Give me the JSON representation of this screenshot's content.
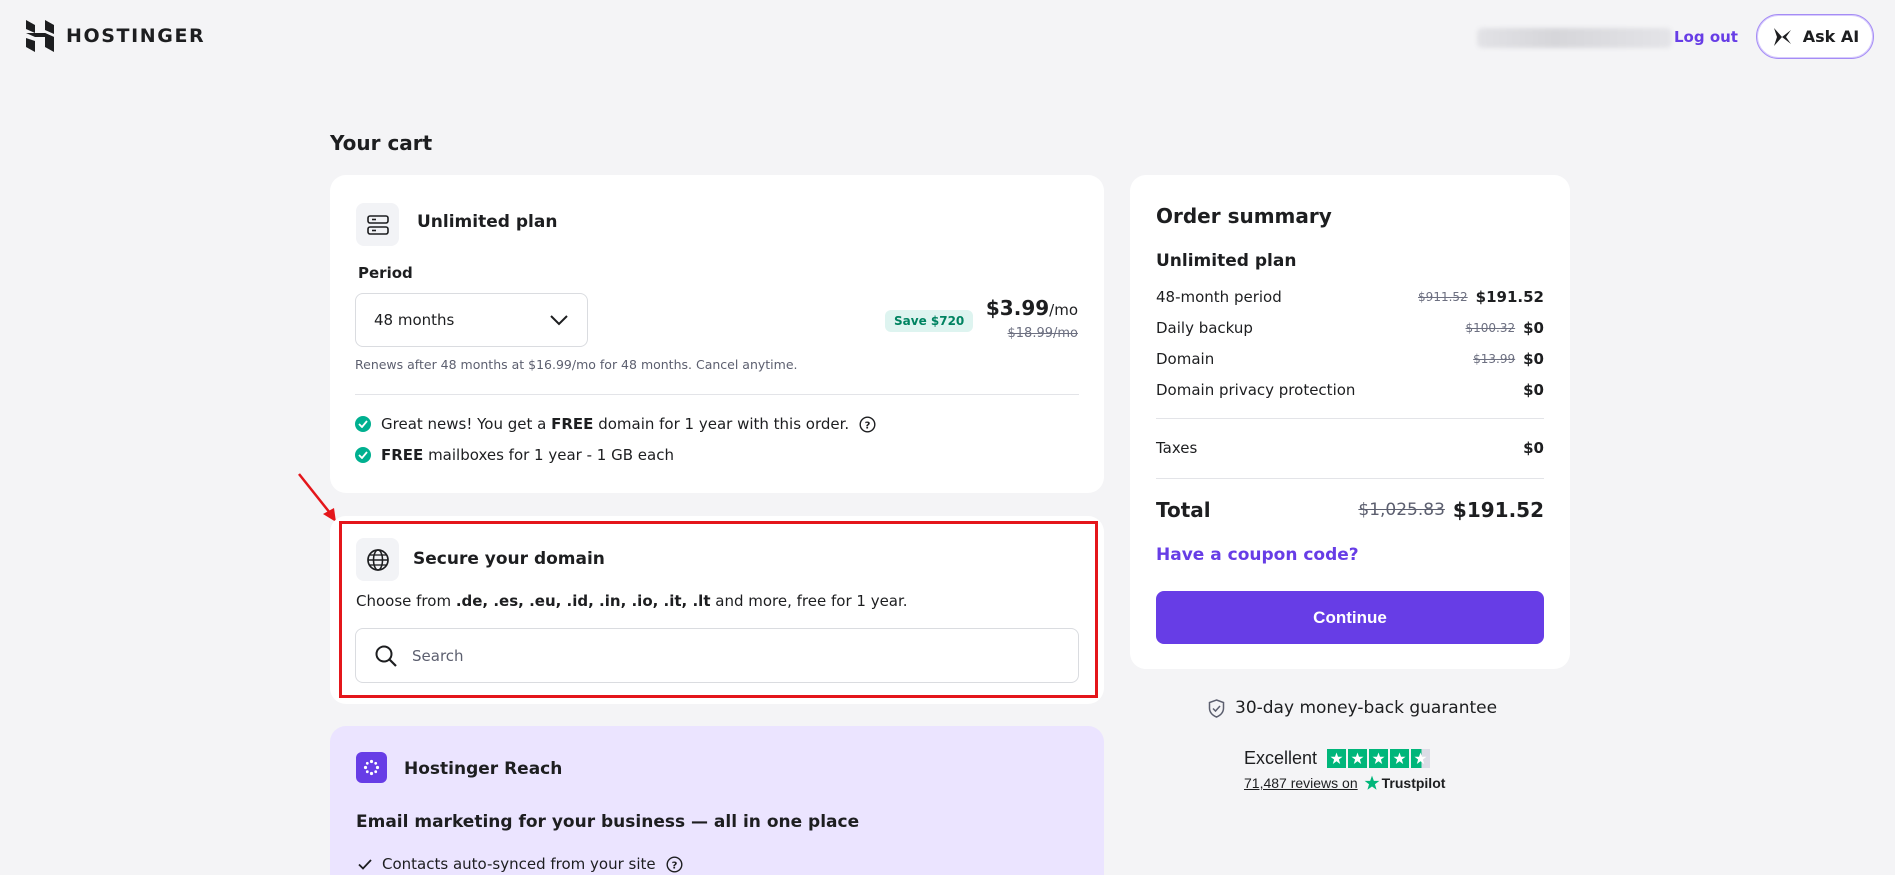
{
  "header": {
    "brand": "HOSTINGER",
    "logout_label": "Log out",
    "ask_ai_label": "Ask AI"
  },
  "cart": {
    "title": "Your cart",
    "plan": {
      "name": "Unlimited plan",
      "period_label": "Period",
      "period_value": "48 months",
      "save_badge": "Save $720",
      "price": "$3.99",
      "price_unit": "/mo",
      "old_price": "$18.99/mo",
      "renew_text": "Renews after 48 months at $16.99/mo for 48 months. Cancel anytime.",
      "features": [
        {
          "pre": "Great news! You get a ",
          "bold": "FREE",
          "post": " domain for 1 year with this order."
        },
        {
          "pre": "",
          "bold": "FREE",
          "post": " mailboxes for 1 year - 1 GB each"
        }
      ]
    },
    "domain": {
      "title": "Secure your domain",
      "sub_pre": "Choose from ",
      "sub_tlds": ".de, .es, .eu, .id, .in, .io, .it, .lt",
      "sub_post": " and more, free for 1 year.",
      "search_placeholder": "Search"
    },
    "reach": {
      "title": "Hostinger Reach",
      "headline": "Email marketing for your business — all in one place",
      "item": "Contacts auto-synced from your site"
    }
  },
  "summary": {
    "title": "Order summary",
    "plan": "Unlimited plan",
    "rows": [
      {
        "label": "48-month period",
        "old": "$911.52",
        "new": "$191.52"
      },
      {
        "label": "Daily backup",
        "old": "$100.32",
        "new": "$0"
      },
      {
        "label": "Domain",
        "old": "$13.99",
        "new": "$0"
      },
      {
        "label": "Domain privacy protection",
        "old": "",
        "new": "$0"
      }
    ],
    "taxes_label": "Taxes",
    "taxes_value": "$0",
    "total_label": "Total",
    "total_old": "$1,025.83",
    "total_new": "$191.52",
    "coupon_label": "Have a coupon code?",
    "continue_label": "Continue"
  },
  "guarantee": "30-day money-back guarantee",
  "trustpilot": {
    "rating_word": "Excellent",
    "stars": 4.5,
    "reviews": "71,487 reviews on",
    "brand": "Trustpilot"
  },
  "colors": {
    "accent": "#673de6",
    "success": "#00b090",
    "highlight": "#e4161b"
  }
}
